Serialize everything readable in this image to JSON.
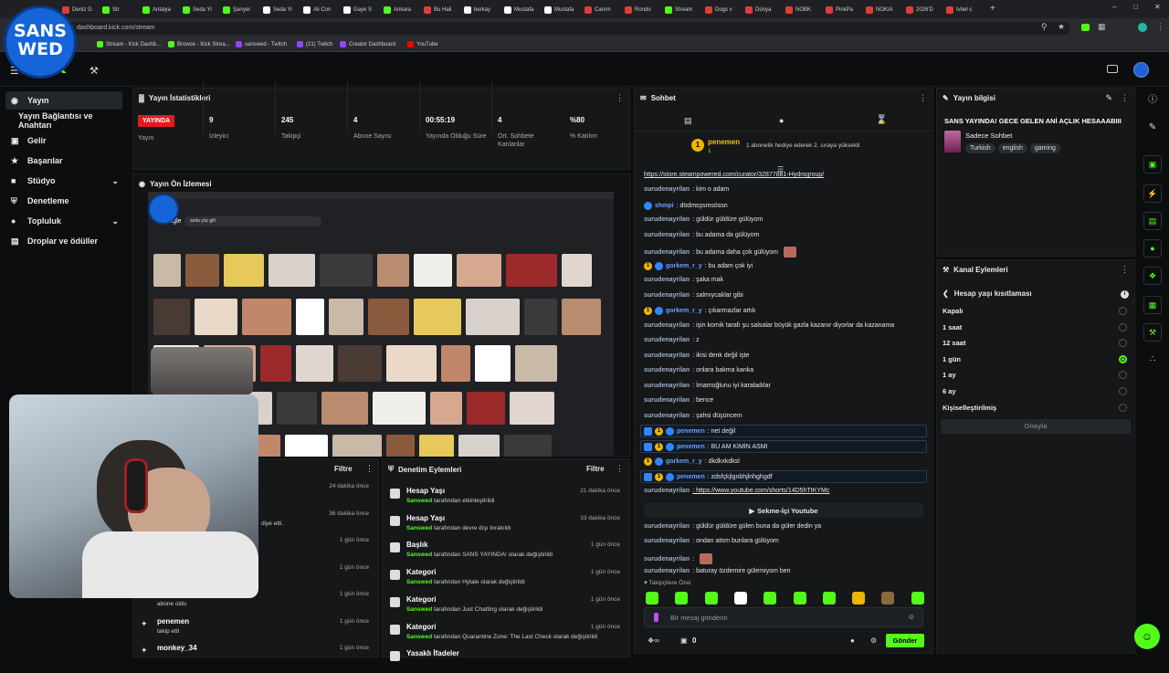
{
  "browser": {
    "tabs": [
      {
        "label": "Deniz G",
        "color": "#e23b3b"
      },
      {
        "label": "Str",
        "color": "#53fc18"
      },
      {
        "label": "Antalya",
        "color": "#53fc18"
      },
      {
        "label": "Seda Yi",
        "color": "#53fc18"
      },
      {
        "label": "Şarıyer",
        "color": "#53fc18"
      },
      {
        "label": "Seda Yi",
        "color": "#ffffff"
      },
      {
        "label": "Ali Con",
        "color": "#ffffff"
      },
      {
        "label": "Gaye S",
        "color": "#ffffff"
      },
      {
        "label": "Ankara",
        "color": "#53fc18"
      },
      {
        "label": "Bu Hali",
        "color": "#e23b3b"
      },
      {
        "label": "berkay",
        "color": "#ffffff"
      },
      {
        "label": "Mustafa",
        "color": "#ffffff"
      },
      {
        "label": "Mustafa",
        "color": "#ffffff"
      },
      {
        "label": "Canım",
        "color": "#e23b3b"
      },
      {
        "label": "Rondo",
        "color": "#e23b3b"
      },
      {
        "label": "Stream",
        "color": "#53fc18"
      },
      {
        "label": "Dogs v",
        "color": "#e23b3b"
      },
      {
        "label": "Dünya",
        "color": "#e23b3b"
      },
      {
        "label": "NOBK",
        "color": "#e23b3b"
      },
      {
        "label": "PinkPa",
        "color": "#e23b3b"
      },
      {
        "label": "NOKIA",
        "color": "#e23b3b"
      },
      {
        "label": "2026'D",
        "color": "#e23b3b"
      },
      {
        "label": "Ivbel c",
        "color": "#e23b3b"
      }
    ],
    "new_tab": "+",
    "url": "dashboard.kick.com/stream",
    "bookmarks": [
      {
        "label": "Stream - Kick Dashb...",
        "color": "#53fc18"
      },
      {
        "label": "Browse - Kick Strea...",
        "color": "#53fc18"
      },
      {
        "label": "sanswed - Twitch",
        "color": "#9146ff"
      },
      {
        "label": "(21) Twitch",
        "color": "#9146ff"
      },
      {
        "label": "Creator Dashboard",
        "color": "#9146ff"
      },
      {
        "label": "YouTube",
        "color": "#ff0000"
      }
    ]
  },
  "overlay": {
    "badge_line1": "SANS",
    "badge_line2": "WED"
  },
  "header": {
    "logo": "kick"
  },
  "sidebar": {
    "items": [
      {
        "label": "Yayın",
        "icon": "broadcast-icon",
        "active": true
      },
      {
        "label": "Yayın Bağlantısı ve Anahtarı",
        "icon": "",
        "active": false
      },
      {
        "label": "Gelir",
        "icon": "money-icon",
        "active": false
      },
      {
        "label": "Başarılar",
        "icon": "trophy-icon",
        "active": false
      },
      {
        "label": "Stüdyo",
        "icon": "studio-icon",
        "active": false,
        "chevron": true
      },
      {
        "label": "Denetleme",
        "icon": "shield-icon",
        "active": false
      },
      {
        "label": "Topluluk",
        "icon": "community-icon",
        "active": false,
        "chevron": true
      },
      {
        "label": "Droplar ve ödüller",
        "icon": "gift-icon",
        "active": false
      }
    ]
  },
  "stats": {
    "title": "Yayın İstatistikleri",
    "live_label": "YAYINDA",
    "live_sub": "Yayın",
    "items": [
      {
        "value": "9",
        "label": "İzleyici"
      },
      {
        "value": "245",
        "label": "Takipçi"
      },
      {
        "value": "4",
        "label": "Abone Sayısı"
      },
      {
        "value": "00:55:19",
        "label": "Yayında Olduğu Süre"
      },
      {
        "value": "4",
        "label": "Ort. Sohbete Katılanlar"
      },
      {
        "value": "%80",
        "label": "% Katılım"
      }
    ]
  },
  "preview": {
    "title": "Yayın Ön İzlemesi",
    "search_text": "seda yüz gifi",
    "google": "Google"
  },
  "activity": {
    "filter": "Filtre",
    "items": [
      {
        "time": "24 dakika önce",
        "sub": ""
      },
      {
        "time": "36 dakika önce",
        "sub": "diye etti."
      },
      {
        "time": "1 gün önce",
        "sub": ""
      },
      {
        "time": "1 gün önce",
        "sub": ""
      },
      {
        "time": "1 gün önce",
        "sub": "abone oldu"
      },
      {
        "title": "penemen",
        "time": "1 gün önce",
        "sub": "takip etti"
      },
      {
        "title": "monkey_34",
        "time": "1 gün önce",
        "sub": ""
      }
    ]
  },
  "mod": {
    "title": "Denetim Eylemleri",
    "filter": "Filtre",
    "items": [
      {
        "title": "Hesap Yaşı",
        "user": "Sanswed",
        "text": " tarafından etkinleştirildi",
        "time": "21 dakika önce"
      },
      {
        "title": "Hesap Yaşı",
        "user": "Sanswed",
        "text": " tarafından devre dışı bırakıldı",
        "time": "33 dakika önce"
      },
      {
        "title": "Başlık",
        "user": "Sanswed",
        "text": " tarafından SANS YAYINDA! olarak değiştirildi",
        "time": "1 gün önce"
      },
      {
        "title": "Kategori",
        "user": "Sanswed",
        "text": " tarafından Hytale olarak değiştirildi",
        "time": "1 gün önce"
      },
      {
        "title": "Kategori",
        "user": "Sanswed",
        "text": " tarafından Just Chatting olarak değiştirildi",
        "time": "1 gün önce"
      },
      {
        "title": "Kategori",
        "user": "Sanswed",
        "text": " tarafından Quarantine Zone: The Last Check olarak değiştirildi",
        "time": "1 gün önce"
      },
      {
        "title": "Yasaklı İfadeler",
        "user": "",
        "text": "",
        "time": ""
      }
    ]
  },
  "chat": {
    "title": "Sohbet",
    "gift_user": "penemen",
    "gift_count": "1",
    "gift_text": "1 abonelik hediye ederek 2. sıraya yükseldi",
    "messages": [
      {
        "user": "",
        "text": "https://store.steampowered.com/curator/32877881-Hydrogroup/",
        "link": true
      },
      {
        "user": "surudenayrilan",
        "text": ": kim o adam"
      },
      {
        "user": "shmpi",
        "text": ": dödmsşsmsössn",
        "badge": "blue"
      },
      {
        "user": "surudenayrilan",
        "text": ": güldür güldüre gülüyom"
      },
      {
        "user": "surudenayrilan",
        "text": ": bu adama da gülüyom"
      },
      {
        "user": "surudenayrilan",
        "text": ": bu adama daha çok gülüyom",
        "emote": true
      },
      {
        "user": "gorkem_r_y",
        "text": ": bu adam çok iyi",
        "badge": "sub"
      },
      {
        "user": "surudenayrilan",
        "text": ": şaka mak"
      },
      {
        "user": "surudenayrilan",
        "text": ": salmıycaklar gibi"
      },
      {
        "user": "gorkem_r_y",
        "text": ": çıkarmazlar artık",
        "badge": "sub"
      },
      {
        "user": "surudenayrilan",
        "text": ": işin komik tarafı şu salsalar büyük gazla kazanır diyorlar da kazanama"
      },
      {
        "user": "surudenayrilan",
        "text": ": z"
      },
      {
        "user": "surudenayrilan",
        "text": ": ikisi denk değil işte"
      },
      {
        "user": "surudenayrilan",
        "text": ": onlara bakma kanka"
      },
      {
        "user": "surudenayrilan",
        "text": ": İmamoğlunu iyi karaladılar"
      },
      {
        "user": "surudenayrilan",
        "text": ": bence"
      },
      {
        "user": "surudenayrilan",
        "text": ": şahsi düşüncem"
      },
      {
        "user": "penemen",
        "text": ": net değil",
        "highlight": true
      },
      {
        "user": "penemen",
        "text": ": BU AM KİMİN ASMI",
        "highlight": true
      },
      {
        "user": "gorkem_r_y",
        "text": ": dkdkxkdksl",
        "badge": "sub"
      },
      {
        "user": "penemen",
        "text": ": zdsfçkjlgnbhjlnhghgdf",
        "highlight": true
      },
      {
        "user": "surudenayrilan",
        "text": ": https://www.youtube.com/shorts/14D5hTtKYMc",
        "linkmsg": true
      },
      {
        "user": "",
        "text": "Sekme-İçi Youtube",
        "youtube": true
      },
      {
        "user": "surudenayrilan",
        "text": ": güldür güldüre gülen buna da güler dedin ya"
      },
      {
        "user": "surudenayrilan",
        "text": ": ondan attım bunlara gülüyom"
      },
      {
        "user": "surudenayrilan",
        "text": ":",
        "emote": true
      },
      {
        "user": "surudenayrilan",
        "text": ": baturay özdemire gülemiyom ben"
      }
    ],
    "followers_only": "Takipçilere Özel",
    "input_placeholder": "Bir mesaj gönderin",
    "points": "0",
    "send_label": "Gönder"
  },
  "info": {
    "title": "Yayın bilgisi",
    "stream_title": "SANS YAYINDA! GECE GELEN ANİ AÇLIK HESAAABIII",
    "category": "Sadece Sohbet",
    "tags": [
      "Turkish",
      "english",
      "gaming"
    ]
  },
  "channel_actions": {
    "title": "Kanal Eylemleri",
    "section": "Hesap yaşı kısıtlaması",
    "options": [
      {
        "label": "Kapalı",
        "selected": false
      },
      {
        "label": "1 saat",
        "selected": false
      },
      {
        "label": "12 saat",
        "selected": false
      },
      {
        "label": "1 gün",
        "selected": true
      },
      {
        "label": "1 ay",
        "selected": false
      },
      {
        "label": "6 ay",
        "selected": false
      },
      {
        "label": "Kişiselleştirilmiş",
        "selected": false
      }
    ],
    "confirm": "Onayla"
  }
}
